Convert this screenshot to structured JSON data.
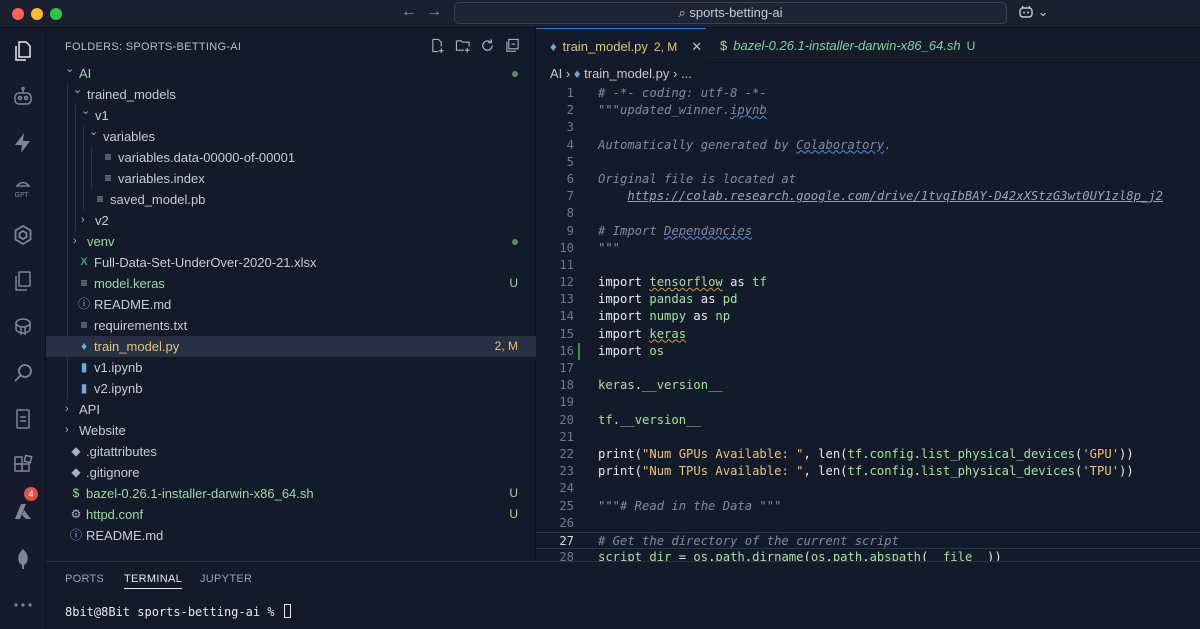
{
  "window": {
    "search_text": "sports-betting-ai",
    "copilot_label": "⌄"
  },
  "activity_bar": {
    "icons": [
      "explorer-icon",
      "copilot-chat-icon",
      "lightning-icon",
      "gpt-icon",
      "openai-icon",
      "copy-icon",
      "database-icon",
      "search-icon",
      "remote-icon",
      "extensions-icon",
      "azure-icon",
      "mongodb-icon",
      "more-icon"
    ],
    "extensions_badge": "4"
  },
  "sidebar": {
    "header": "FOLDERS: SPORTS-BETTING-AI",
    "tree": [
      {
        "label": "AI",
        "depth": 0,
        "kind": "folder-open",
        "color": "#9ed8a6",
        "dot": "#5f8b65"
      },
      {
        "label": "trained_models",
        "depth": 1,
        "kind": "folder-open",
        "color": "#c6ccd8"
      },
      {
        "label": "v1",
        "depth": 2,
        "kind": "folder-open",
        "color": "#c6ccd8"
      },
      {
        "label": "variables",
        "depth": 3,
        "kind": "folder-open",
        "color": "#c6ccd8"
      },
      {
        "label": "variables.data-00000-of-00001",
        "depth": 4,
        "kind": "file-lines",
        "color": "#c6ccd8"
      },
      {
        "label": "variables.index",
        "depth": 4,
        "kind": "file-lines",
        "color": "#c6ccd8"
      },
      {
        "label": "saved_model.pb",
        "depth": 3,
        "kind": "file-lines",
        "color": "#c6ccd8"
      },
      {
        "label": "v2",
        "depth": 2,
        "kind": "folder-closed",
        "color": "#c6ccd8"
      },
      {
        "label": "venv",
        "depth": 1,
        "kind": "folder-closed",
        "color": "#9ed8a6",
        "dot": "#5f8b65"
      },
      {
        "label": "Full-Data-Set-UnderOver-2020-21.xlsx",
        "depth": 1,
        "kind": "excel",
        "color": "#c6ccd8"
      },
      {
        "label": "model.keras",
        "depth": 1,
        "kind": "file-lines",
        "color": "#9ed8a6",
        "status": "U",
        "status_color": "#9ed8a6"
      },
      {
        "label": "README.md",
        "depth": 1,
        "kind": "info",
        "color": "#c6ccd8"
      },
      {
        "label": "requirements.txt",
        "depth": 1,
        "kind": "file-lines",
        "color": "#c6ccd8"
      },
      {
        "label": "train_model.py",
        "depth": 1,
        "kind": "python",
        "color": "#e6c47a",
        "status": "2, M",
        "status_color": "#e6c47a",
        "selected": true
      },
      {
        "label": "v1.ipynb",
        "depth": 1,
        "kind": "notebook",
        "color": "#c6ccd8"
      },
      {
        "label": "v2.ipynb",
        "depth": 1,
        "kind": "notebook",
        "color": "#c6ccd8"
      },
      {
        "label": "API",
        "depth": 0,
        "kind": "folder-closed",
        "color": "#c6ccd8"
      },
      {
        "label": "Website",
        "depth": 0,
        "kind": "folder-closed",
        "color": "#c6ccd8"
      },
      {
        "label": ".gitattributes",
        "depth": 0,
        "kind": "git",
        "color": "#c6ccd8"
      },
      {
        "label": ".gitignore",
        "depth": 0,
        "kind": "git",
        "color": "#c6ccd8"
      },
      {
        "label": "bazel-0.26.1-installer-darwin-x86_64.sh",
        "depth": 0,
        "kind": "shell",
        "color": "#9ed8a6",
        "status": "U",
        "status_color": "#9ed8a6"
      },
      {
        "label": "httpd.conf",
        "depth": 0,
        "kind": "gear",
        "color": "#9ed8a6",
        "status": "U",
        "status_color": "#9ed8a6"
      },
      {
        "label": "README.md",
        "depth": 0,
        "kind": "info",
        "color": "#c6ccd8"
      }
    ]
  },
  "tabs": [
    {
      "label": "train_model.py",
      "status": "2, M",
      "active": true
    },
    {
      "label": "bazel-0.26.1-installer-darwin-x86_64.sh",
      "status": "U",
      "active": false
    }
  ],
  "breadcrumb": {
    "folder": "AI",
    "file": "train_model.py",
    "rest": "..."
  },
  "editor": {
    "current_line": 27,
    "modified_line": 16,
    "lines": [
      {
        "n": 1,
        "tokens": [
          [
            "cm",
            "# -*- coding: utf-8 -*-"
          ]
        ]
      },
      {
        "n": 2,
        "tokens": [
          [
            "cm",
            "\"\"\"updated_winner."
          ],
          [
            "cm squig",
            "ipynb"
          ]
        ]
      },
      {
        "n": 3,
        "tokens": []
      },
      {
        "n": 4,
        "tokens": [
          [
            "cm",
            "Automatically generated by "
          ],
          [
            "cm squig",
            "Colaboratory"
          ],
          [
            "cm",
            "."
          ]
        ]
      },
      {
        "n": 5,
        "tokens": []
      },
      {
        "n": 6,
        "tokens": [
          [
            "cm",
            "Original file is located at"
          ]
        ]
      },
      {
        "n": 7,
        "tokens": [
          [
            "cm",
            "    "
          ],
          [
            "url",
            "https://colab.research.google.com/drive/1tvqIbBAY-D42xXStzG3wt0UY1zl8p_j2"
          ]
        ]
      },
      {
        "n": 8,
        "tokens": []
      },
      {
        "n": 9,
        "tokens": [
          [
            "cm",
            "# Import "
          ],
          [
            "cm squig",
            "Dependancies"
          ]
        ]
      },
      {
        "n": 10,
        "tokens": [
          [
            "cm",
            "\"\"\""
          ]
        ]
      },
      {
        "n": 11,
        "tokens": []
      },
      {
        "n": 12,
        "tokens": [
          [
            "kw",
            "import "
          ],
          [
            "mod squig-o",
            "tensorflow"
          ],
          [
            "kw",
            " as "
          ],
          [
            "mod",
            "tf"
          ]
        ]
      },
      {
        "n": 13,
        "tokens": [
          [
            "kw",
            "import "
          ],
          [
            "mod",
            "pandas"
          ],
          [
            "kw",
            " as "
          ],
          [
            "mod",
            "pd"
          ]
        ]
      },
      {
        "n": 14,
        "tokens": [
          [
            "kw",
            "import "
          ],
          [
            "mod",
            "numpy"
          ],
          [
            "kw",
            " as "
          ],
          [
            "mod",
            "np"
          ]
        ]
      },
      {
        "n": 15,
        "tokens": [
          [
            "kw",
            "import "
          ],
          [
            "mod squig-o",
            "keras"
          ]
        ]
      },
      {
        "n": 16,
        "tokens": [
          [
            "kw",
            "import "
          ],
          [
            "mod",
            "os"
          ]
        ]
      },
      {
        "n": 17,
        "tokens": []
      },
      {
        "n": 18,
        "tokens": [
          [
            "mod",
            "keras"
          ],
          [
            "fn",
            "."
          ],
          [
            "mod",
            "__version__"
          ]
        ]
      },
      {
        "n": 19,
        "tokens": []
      },
      {
        "n": 20,
        "tokens": [
          [
            "mod",
            "tf"
          ],
          [
            "fn",
            "."
          ],
          [
            "mod",
            "__version__"
          ]
        ]
      },
      {
        "n": 21,
        "tokens": []
      },
      {
        "n": 22,
        "tokens": [
          [
            "fn",
            "print("
          ],
          [
            "str",
            "\"Num GPUs Available: \""
          ],
          [
            "fn",
            ", len("
          ],
          [
            "mod",
            "tf"
          ],
          [
            "fn",
            "."
          ],
          [
            "mod",
            "config"
          ],
          [
            "fn",
            "."
          ],
          [
            "mod",
            "list_physical_devices"
          ],
          [
            "fn",
            "("
          ],
          [
            "str",
            "'GPU'"
          ],
          [
            "fn",
            "))"
          ]
        ]
      },
      {
        "n": 23,
        "tokens": [
          [
            "fn",
            "print("
          ],
          [
            "str",
            "\"Num TPUs Available: \""
          ],
          [
            "fn",
            ", len("
          ],
          [
            "mod",
            "tf"
          ],
          [
            "fn",
            "."
          ],
          [
            "mod",
            "config"
          ],
          [
            "fn",
            "."
          ],
          [
            "mod",
            "list_physical_devices"
          ],
          [
            "fn",
            "("
          ],
          [
            "str",
            "'TPU'"
          ],
          [
            "fn",
            "))"
          ]
        ]
      },
      {
        "n": 24,
        "tokens": []
      },
      {
        "n": 25,
        "tokens": [
          [
            "cm",
            "\"\"\"# Read in the Data \"\"\""
          ]
        ]
      },
      {
        "n": 26,
        "tokens": []
      },
      {
        "n": 27,
        "tokens": [
          [
            "cm",
            "# Get the directory of the current script"
          ]
        ]
      },
      {
        "n": 28,
        "tokens": [
          [
            "mod",
            "script_dir"
          ],
          [
            "fn",
            " = "
          ],
          [
            "mod",
            "os"
          ],
          [
            "fn",
            "."
          ],
          [
            "mod",
            "path"
          ],
          [
            "fn",
            "."
          ],
          [
            "mod",
            "dirname"
          ],
          [
            "fn",
            "("
          ],
          [
            "mod",
            "os"
          ],
          [
            "fn",
            "."
          ],
          [
            "mod",
            "path"
          ],
          [
            "fn",
            "."
          ],
          [
            "mod",
            "abspath"
          ],
          [
            "fn",
            "("
          ],
          [
            "mod",
            "__file__"
          ],
          [
            "fn",
            "))"
          ]
        ]
      }
    ]
  },
  "panel": {
    "tabs": [
      "PORTS",
      "TERMINAL",
      "JUPYTER"
    ],
    "active_tab": "TERMINAL",
    "prompt": "8bit@8Bit sports-betting-ai % "
  }
}
